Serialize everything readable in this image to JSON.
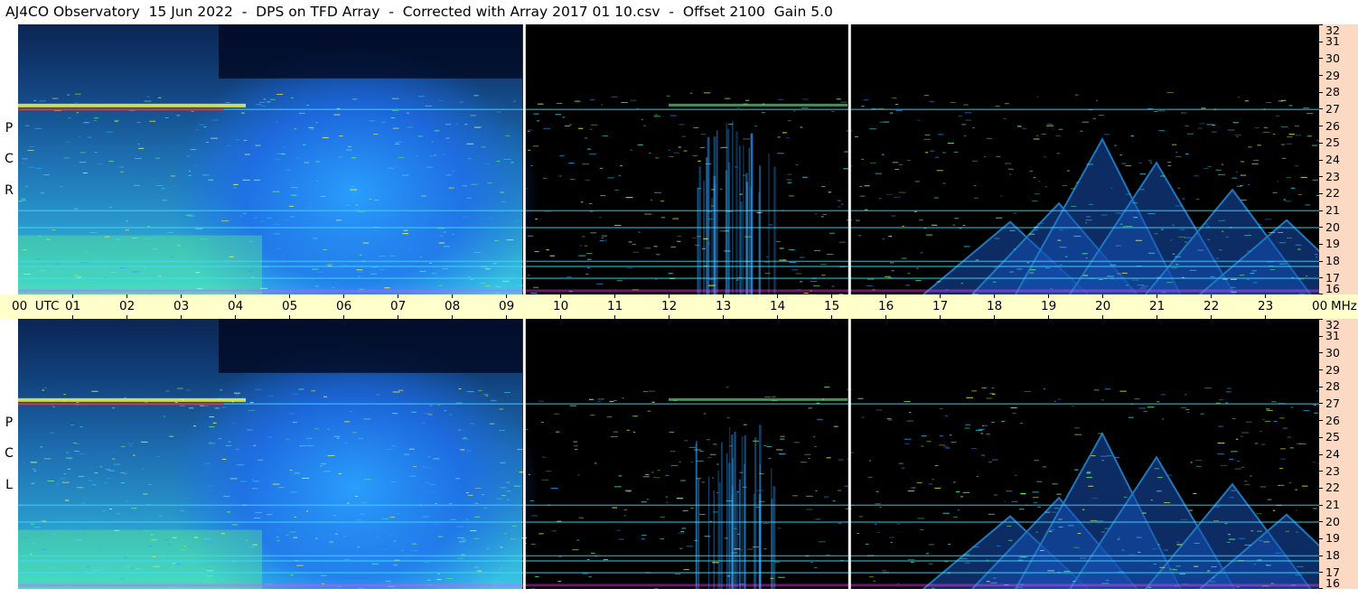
{
  "title": "AJ4CO Observatory  15 Jun 2022  -  DPS on TFD Array  -  Corrected with Array 2017 01 10.csv  -  Offset 2100  Gain 5.0",
  "panels": [
    {
      "id": "top",
      "label_letters": [
        "R",
        "C",
        "P"
      ]
    },
    {
      "id": "bottom",
      "label_letters": [
        "L",
        "C",
        "P"
      ]
    }
  ],
  "time_axis": {
    "labels": [
      "00  UTC",
      "01",
      "02",
      "03",
      "04",
      "05",
      "06",
      "07",
      "08",
      "09",
      "10",
      "11",
      "12",
      "13",
      "14",
      "15",
      "16",
      "17",
      "18",
      "19",
      "20",
      "21",
      "22",
      "23",
      "00"
    ],
    "unit_right": "MHz"
  },
  "freq_axis": {
    "labels": [
      "32",
      "31",
      "30",
      "29",
      "28",
      "27",
      "26",
      "25",
      "24",
      "23",
      "22",
      "21",
      "20",
      "19",
      "18",
      "17",
      "16"
    ]
  },
  "colors": {
    "background": "#000000",
    "diffuse_blue": "#1e6cf0",
    "bright_blue": "#2aa0ff",
    "cyan": "#40e0ff",
    "green": "#60ff80",
    "yellow": "#ffff40",
    "red": "#ff2020",
    "magenta": "#ff40ff",
    "time_axis_bg": "#ffffcc",
    "freq_axis_bg": "#fbd9c2"
  },
  "chart_data": {
    "type": "heatmap",
    "title": "AJ4CO Observatory  15 Jun 2022  -  DPS on TFD Array  -  Corrected with Array 2017 01 10.csv  -  Offset 2100  Gain 5.0",
    "x_axis": {
      "label": "UTC",
      "range": [
        0,
        24
      ]
    },
    "y_axis": {
      "label": "MHz",
      "range": [
        16,
        32
      ]
    },
    "subplots": [
      "RCP",
      "LCP"
    ],
    "features": {
      "diffuse_morning_emission_utc": [
        0,
        9.3
      ],
      "vertical_line_utc": [
        9.33,
        15.33
      ],
      "interference_bands_mhz": [
        17.0,
        17.7,
        18.0,
        20.0,
        21.0,
        27.0
      ],
      "arch_emission": {
        "utc_range": [
          16.7,
          23.6
        ],
        "peak_utc": 20.0,
        "peak_mhz": 25.2
      },
      "afternoon_burst": {
        "utc_range": [
          12.4,
          14.0
        ],
        "top_mhz": 26.5
      }
    }
  }
}
